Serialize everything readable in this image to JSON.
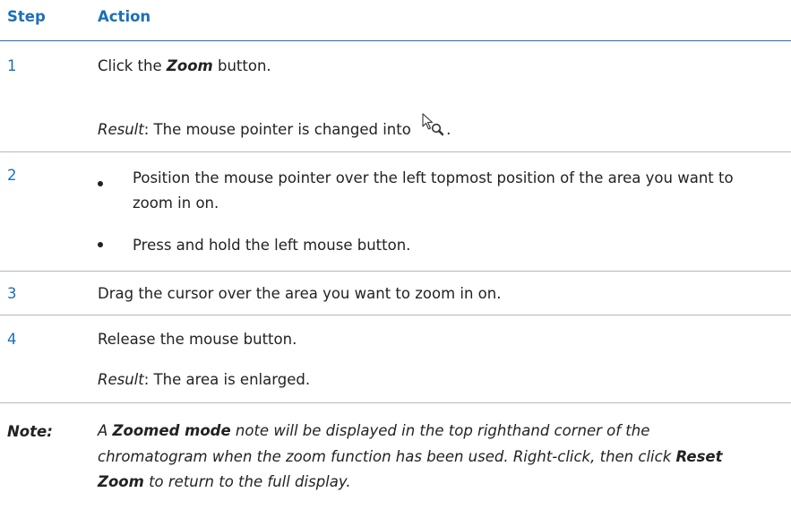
{
  "header": {
    "step": "Step",
    "action": "Action"
  },
  "steps": [
    {
      "number": "1",
      "line1_pre": "Click the ",
      "line1_bold": "Zoom",
      "line1_post": " button.",
      "result_label": "Result",
      "result_text": ": The mouse pointer is changed into ",
      "result_icon": "zoom-cursor-icon",
      "result_end": "."
    },
    {
      "number": "2",
      "bullets": [
        "Position the mouse pointer over the left topmost position of the area you want to zoom in on.",
        "Press and hold the left mouse button."
      ]
    },
    {
      "number": "3",
      "text": "Drag the cursor over the area you want to zoom in on."
    },
    {
      "number": "4",
      "text": "Release the mouse button.",
      "result_label": "Result",
      "result_text": ": The area is enlarged."
    }
  ],
  "note": {
    "label": "Note:",
    "t1": "A ",
    "b1": "Zoomed mode",
    "t2": " note will be displayed in the top righthand corner of the chromatogram when the zoom function has been used. Right-click, then click ",
    "b2": "Reset Zoom",
    "t3": " to return to the full display."
  },
  "colors": {
    "accent": "#1d6fb8",
    "rule_grey": "#b8b8b8",
    "text": "#222222"
  }
}
